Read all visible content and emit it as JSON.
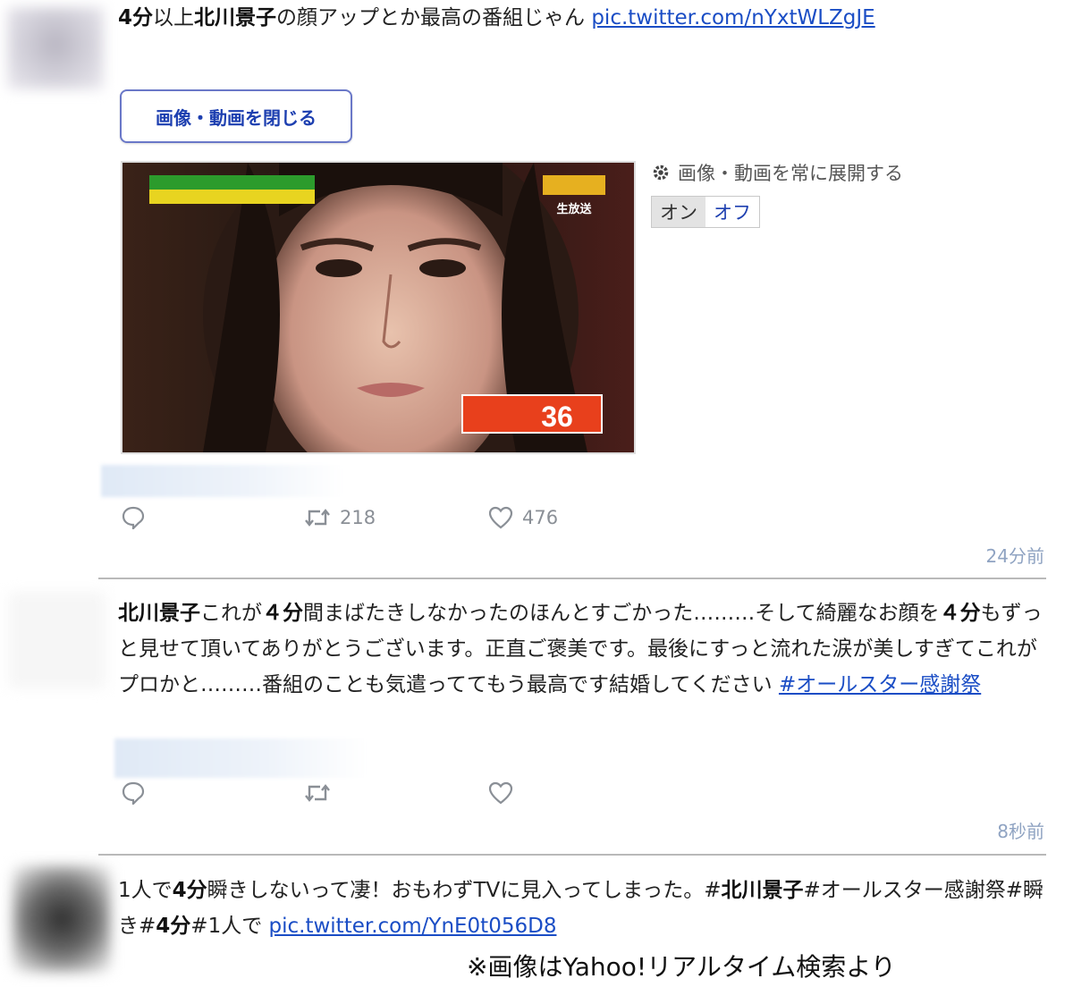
{
  "tweet1": {
    "text_bold1": "4分",
    "text_mid1": "以上",
    "text_bold2": "北川景子",
    "text_rest": "の顔アップとか最高の番組じゃん ",
    "link": "pic.twitter.com/nYxtWLZgJE",
    "close_media_button": "画像・動画を閉じる",
    "media_setting_label": "画像・動画を常に展開する",
    "toggle_on": "オン",
    "toggle_off": "オフ",
    "image_score": "36",
    "image_badge": "生放送",
    "retweets": "218",
    "likes": "476",
    "time": "24分前"
  },
  "tweet2": {
    "bold_name": "北川景子",
    "t1": "これが",
    "bold_4min": "４分",
    "t2": "間まばたきしなかったのほんとすごかった………そして綺麗なお顔を",
    "bold_4min_b": "４分",
    "t3": "もずっと見せて頂いてありがとうございます。正直ご褒美です。最後にすっと流れた涙が美しすぎてこれがプロかと………番組のことも気遣っててもう最高です結婚してください ",
    "hashtag": "#オールスター感謝祭",
    "time": "8秒前"
  },
  "tweet3": {
    "t1": "1人で",
    "bold_4min": "4分",
    "t2": "瞬きしないって凄！おもわずTVに見入ってしまった。#",
    "bold_name": "北川景子",
    "t3": "#オールスター感謝祭#瞬き#",
    "bold_4min_b": "4分",
    "t4": "#1人で ",
    "link": "pic.twitter.com/YnE0t056D8"
  },
  "credit": "※画像はYahoo!リアルタイム検索より",
  "icons": [
    "reply-icon",
    "retweet-icon",
    "heart-icon",
    "gear-icon"
  ],
  "colors": {
    "link": "#1a4dc5",
    "time": "#8fa3c2",
    "score_bar": "#e8401c"
  }
}
